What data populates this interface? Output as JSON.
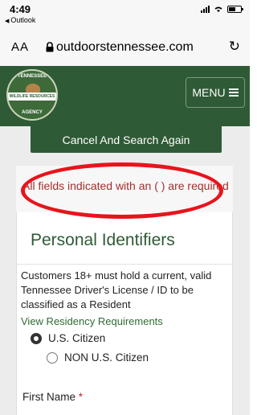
{
  "status_bar": {
    "time": "4:49",
    "back_app": "Outlook"
  },
  "browser": {
    "text_size_label": "AA",
    "url": "outdoorstennessee.com"
  },
  "header": {
    "logo_text_top": "TENNESSEE",
    "logo_text_band": "WILDLIFE RESOURCES",
    "logo_text_bottom": "AGENCY",
    "menu_label": "MENU"
  },
  "main": {
    "cancel_button": "Cancel And Search Again",
    "required_note": "All fields indicated with an ( ) are required",
    "section_title": "Personal Identifiers",
    "info_text": "Customers 18+ must hold a current, valid Tennessee Driver's License / ID to be classified as a Resident",
    "residency_link": "View Residency Requirements",
    "citizenship_options": [
      {
        "label": "U.S. Citizen",
        "selected": true
      },
      {
        "label": "NON U.S. Citizen",
        "selected": false
      }
    ],
    "first_name_label": "First Name",
    "required_marker": "*"
  },
  "colors": {
    "brand_green": "#2f5a36",
    "required_red": "#a3302c",
    "annotation_red": "#e8141c"
  }
}
